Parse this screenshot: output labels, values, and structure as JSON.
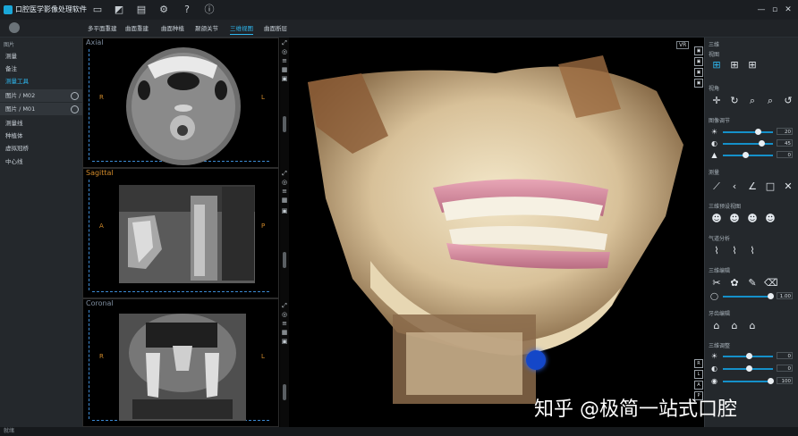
{
  "app": {
    "title": "口腔医学影像处理软件",
    "window_buttons": {
      "minimize": "—",
      "maximize": "▫",
      "close": "✕"
    }
  },
  "toolbar_icons": [
    "folder-icon",
    "edit-icon",
    "print-icon",
    "gear-icon",
    "help-icon",
    "info-icon"
  ],
  "user": {
    "name": "",
    "extra": ""
  },
  "tabs": [
    {
      "label": "多平面重建",
      "active": false
    },
    {
      "label": "曲面重建",
      "active": false
    },
    {
      "label": "曲面种植",
      "active": false
    },
    {
      "label": "颞颌关节",
      "active": false
    },
    {
      "label": "三维视图",
      "active": true
    },
    {
      "label": "曲面断层",
      "active": false
    }
  ],
  "left_panel": {
    "header": "图片",
    "items": [
      {
        "label": "测量",
        "selected": false,
        "image": false
      },
      {
        "label": "备注",
        "selected": false,
        "image": false
      },
      {
        "label": "测量工具",
        "selected": true,
        "image": false
      },
      {
        "label": "图片 / M02",
        "selected": false,
        "image": true
      },
      {
        "label": "图片 / M01",
        "selected": false,
        "image": true
      },
      {
        "label": "测量线",
        "selected": false,
        "image": false
      },
      {
        "label": "种植体",
        "selected": false,
        "image": false
      },
      {
        "label": "虚拟冠桥",
        "selected": false,
        "image": false
      },
      {
        "label": "中心线",
        "selected": false,
        "image": false
      }
    ]
  },
  "panes": {
    "axial": {
      "label": "Axial",
      "left": "R",
      "right": "L"
    },
    "sagittal": {
      "label": "Sagittal",
      "left": "A",
      "right": "P"
    },
    "coronal": {
      "label": "Coronal",
      "left": "R",
      "right": "L"
    }
  },
  "main_view": {
    "tag": "VR"
  },
  "right_panel": {
    "header": "三维",
    "sections": [
      {
        "title": "视图"
      },
      {
        "title": "视角"
      },
      {
        "title": "图像调节"
      },
      {
        "title": "测量"
      },
      {
        "title": "三维预设视图"
      },
      {
        "title": "气道分析"
      },
      {
        "title": "三维编辑"
      },
      {
        "title": "牙齿编辑"
      },
      {
        "title": "三维调整"
      }
    ],
    "adjust_values": [
      "20",
      "45",
      "0"
    ],
    "edit_value": "1.00",
    "bottom_values": [
      "0",
      "0",
      "100"
    ]
  },
  "watermark": "知乎 @极简一站式口腔",
  "status": "就绪"
}
